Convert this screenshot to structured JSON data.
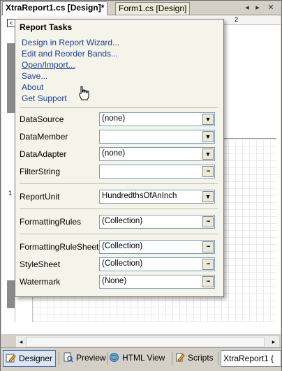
{
  "tabs": [
    {
      "label": "XtraReport1.cs [Design]*",
      "active": true
    },
    {
      "label": "Form1.cs [Design]",
      "active": false
    }
  ],
  "tab_controls": {
    "nav_left": "◂",
    "nav_right": "▸",
    "close": "✕"
  },
  "ruler": {
    "tick_label": "2"
  },
  "left_ruler": {
    "tick_label": "1"
  },
  "expander_glyph": "<",
  "smart_tag": {
    "title": "Report Tasks",
    "links": [
      {
        "label": "Design in Report Wizard...",
        "hover": false
      },
      {
        "label": "Edit and Reorder Bands...",
        "hover": false
      },
      {
        "label": "Open/Import...",
        "hover": true
      },
      {
        "label": "Save...",
        "hover": false
      },
      {
        "label": "About",
        "hover": false
      },
      {
        "label": "Get Support",
        "hover": false
      }
    ],
    "properties": [
      {
        "label": "DataSource",
        "value": "(none)",
        "editor": "dropdown"
      },
      {
        "label": "DataMember",
        "value": "",
        "editor": "dropdown"
      },
      {
        "label": "DataAdapter",
        "value": "(none)",
        "editor": "dropdown"
      },
      {
        "label": "FilterString",
        "value": "",
        "editor": "ellipsis"
      },
      {
        "label": "ReportUnit",
        "value": "HundredthsOfAnInch",
        "editor": "dropdown"
      },
      {
        "label": "FormattingRules",
        "value": "(Collection)",
        "editor": "ellipsis"
      },
      {
        "label": "FormattingRuleSheet",
        "value": "(Collection)",
        "editor": "ellipsis"
      },
      {
        "label": "StyleSheet",
        "value": "(Collection)",
        "editor": "ellipsis"
      },
      {
        "label": "Watermark",
        "value": "(None)",
        "editor": "ellipsis"
      }
    ]
  },
  "view_buttons": [
    {
      "label": "Designer",
      "active": true,
      "icon": "designer-icon"
    },
    {
      "label": "Preview",
      "active": false,
      "icon": "preview-icon"
    },
    {
      "label": "HTML View",
      "active": false,
      "icon": "html-view-icon"
    },
    {
      "label": "Scripts",
      "active": false,
      "icon": "scripts-icon"
    }
  ],
  "component_tray": {
    "label": "XtraReport1 {"
  },
  "scroll": {
    "left": "◂",
    "right": "▸"
  },
  "colors": {
    "link": "#1b3f97",
    "panel_bg": "#f5f4ea",
    "active_view": "#dbe6f6",
    "chrome": "#d4d0c8"
  }
}
